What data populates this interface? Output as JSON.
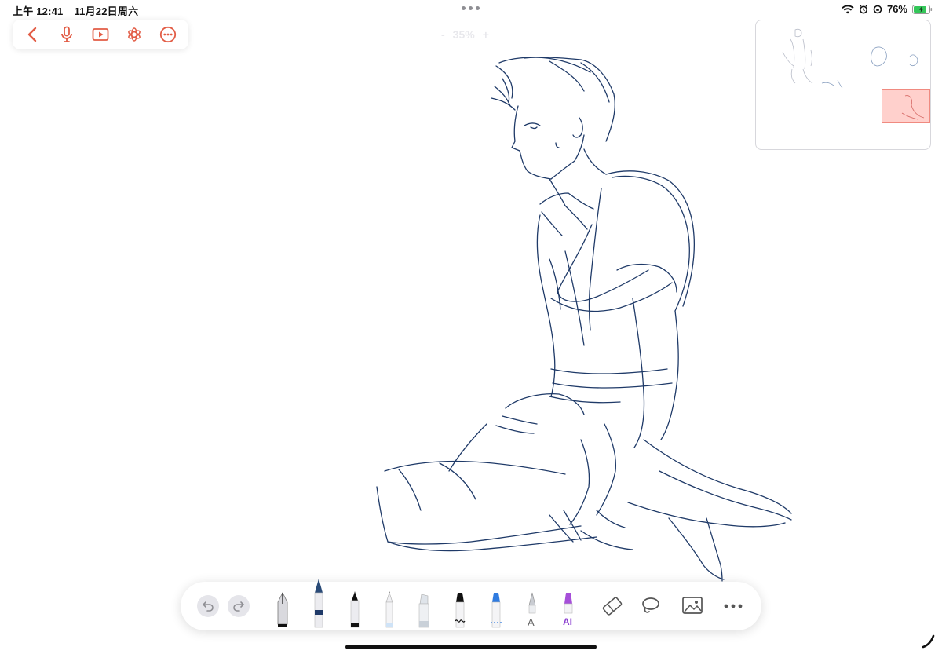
{
  "status_bar": {
    "time": "上午 12:41",
    "date": "11月22日周六",
    "battery_percent": "76%",
    "icons": [
      "wifi-icon",
      "alarm-icon",
      "orientation-lock-icon",
      "battery-icon"
    ]
  },
  "top_toolbar": {
    "buttons": [
      "back-icon",
      "microphone-icon",
      "play-icon",
      "ai-assistant-icon",
      "more-options-icon"
    ],
    "accent_color": "#e25c45"
  },
  "zoom": {
    "minus": "-",
    "value": "35%",
    "plus": "+"
  },
  "palette": {
    "history": [
      "undo-icon",
      "redo-icon"
    ],
    "tools": [
      {
        "name": "fountain-pen",
        "label": ""
      },
      {
        "name": "ballpoint-pen",
        "label": ""
      },
      {
        "name": "brush-pen",
        "label": ""
      },
      {
        "name": "pencil",
        "label": ""
      },
      {
        "name": "highlighter",
        "label": ""
      },
      {
        "name": "shape-pen",
        "label": ""
      },
      {
        "name": "dashed-pen",
        "label": ""
      },
      {
        "name": "text-tool",
        "label": "A"
      },
      {
        "name": "ai-pen",
        "label": "AI"
      }
    ],
    "actions": [
      "eraser-icon",
      "lasso-icon",
      "image-icon",
      "more-icon"
    ]
  },
  "colors": {
    "stroke": "#1f3a68",
    "accent": "#e25c45"
  }
}
